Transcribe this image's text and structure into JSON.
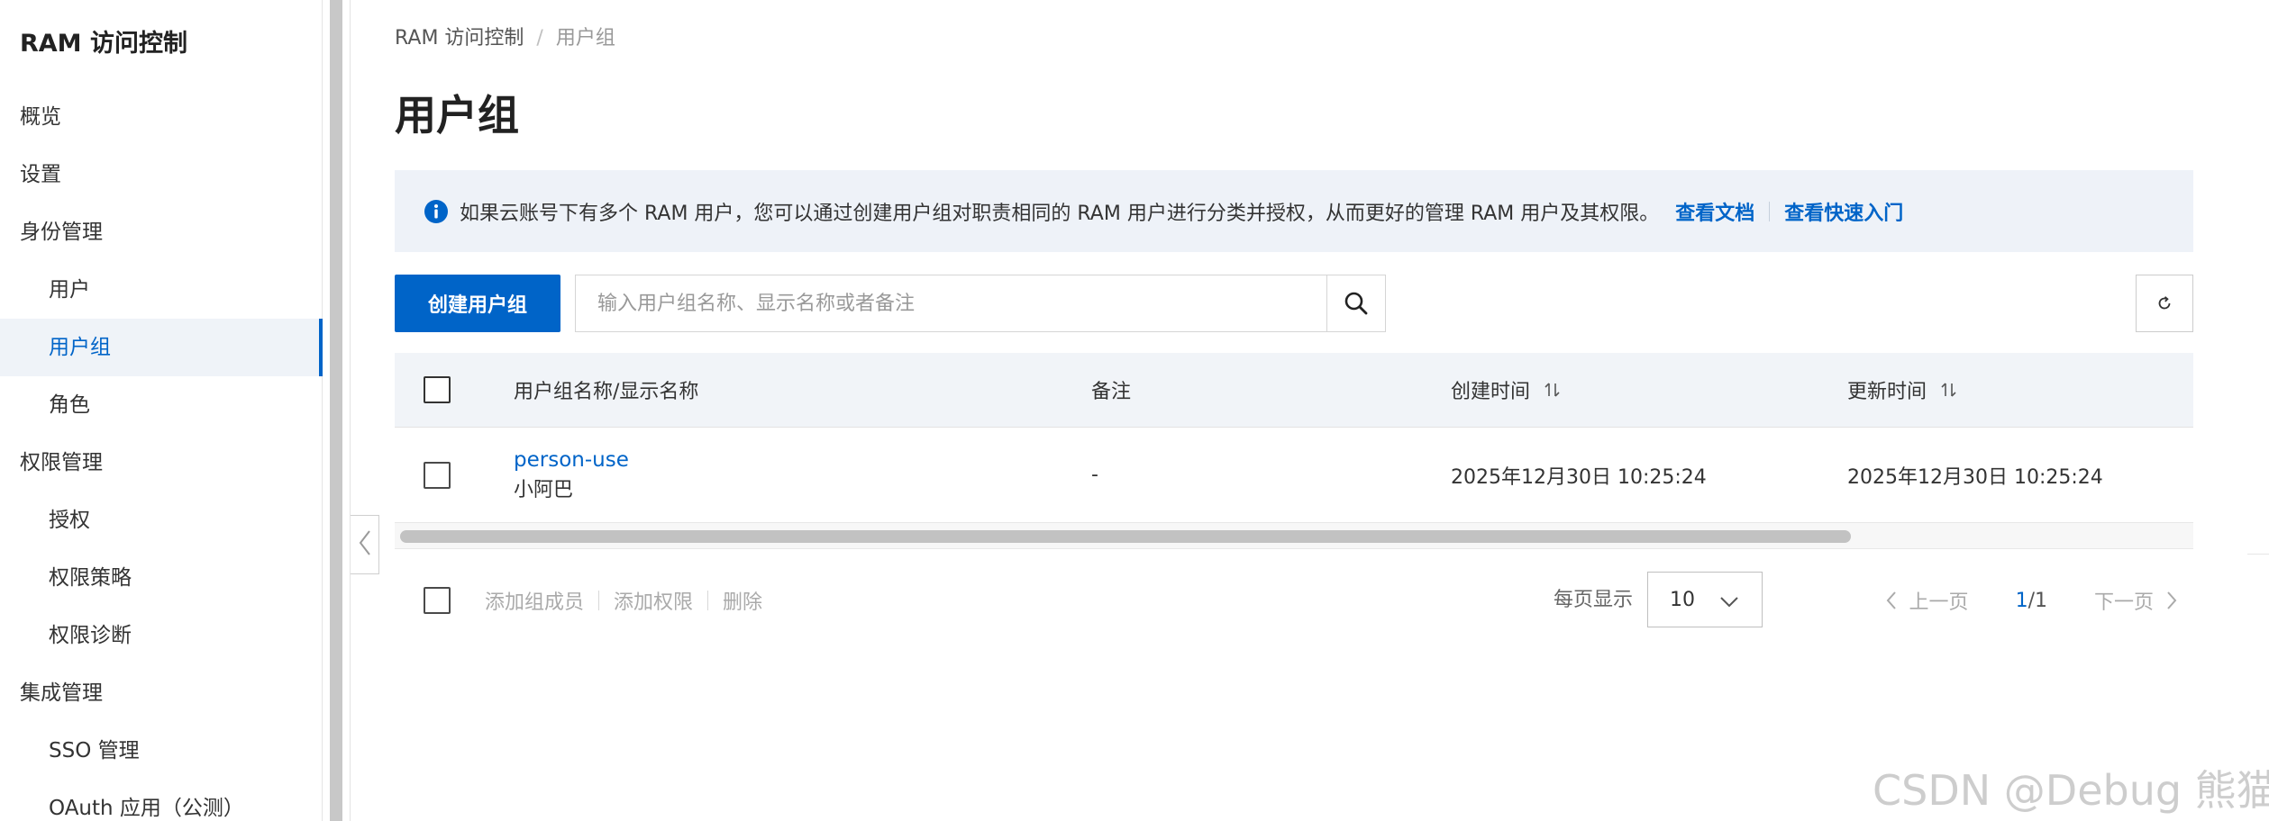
{
  "sidebar": {
    "title": "RAM 访问控制",
    "items": [
      {
        "label": "概览",
        "level": 1,
        "active": false
      },
      {
        "label": "设置",
        "level": 1,
        "active": false
      },
      {
        "label": "身份管理",
        "level": 1,
        "active": false
      },
      {
        "label": "用户",
        "level": 2,
        "active": false
      },
      {
        "label": "用户组",
        "level": 2,
        "active": true
      },
      {
        "label": "角色",
        "level": 2,
        "active": false
      },
      {
        "label": "权限管理",
        "level": 1,
        "active": false
      },
      {
        "label": "授权",
        "level": 2,
        "active": false
      },
      {
        "label": "权限策略",
        "level": 2,
        "active": false
      },
      {
        "label": "权限诊断",
        "level": 2,
        "active": false
      },
      {
        "label": "集成管理",
        "level": 1,
        "active": false
      },
      {
        "label": "SSO 管理",
        "level": 2,
        "active": false
      },
      {
        "label": "OAuth 应用（公测）",
        "level": 2,
        "active": false
      }
    ]
  },
  "breadcrumb": {
    "root": "RAM 访问控制",
    "separator": "/",
    "current": "用户组"
  },
  "page": {
    "title": "用户组"
  },
  "notice": {
    "icon": "info-icon",
    "text": "如果云账号下有多个 RAM 用户，您可以通过创建用户组对职责相同的 RAM 用户进行分类并授权，从而更好的管理 RAM 用户及其权限。",
    "link_docs": "查看文档",
    "link_quickstart": "查看快速入门"
  },
  "toolbar": {
    "create_label": "创建用户组",
    "search_placeholder": "输入用户组名称、显示名称或者备注",
    "search_value": ""
  },
  "table": {
    "columns": [
      "用户组名称/显示名称",
      "备注",
      "创建时间",
      "更新时间"
    ],
    "rows": [
      {
        "name": "person-use",
        "display_name": "小阿巴",
        "remark": "-",
        "created": "2025年12月30日 10:25:24",
        "updated": "2025年12月30日 10:25:24"
      }
    ]
  },
  "footer": {
    "add_members": "添加组成员",
    "add_permissions": "添加权限",
    "delete": "删除",
    "page_size_label": "每页显示",
    "page_size": "10",
    "prev": "上一页",
    "next": "下一页",
    "current_page": "1",
    "page_total": "/1"
  },
  "watermark": "CSDN @Debug 熊猫",
  "colors": {
    "primary": "#0064c8",
    "notice_bg": "#eef2f8",
    "table_header_bg": "#f1f4f8"
  }
}
